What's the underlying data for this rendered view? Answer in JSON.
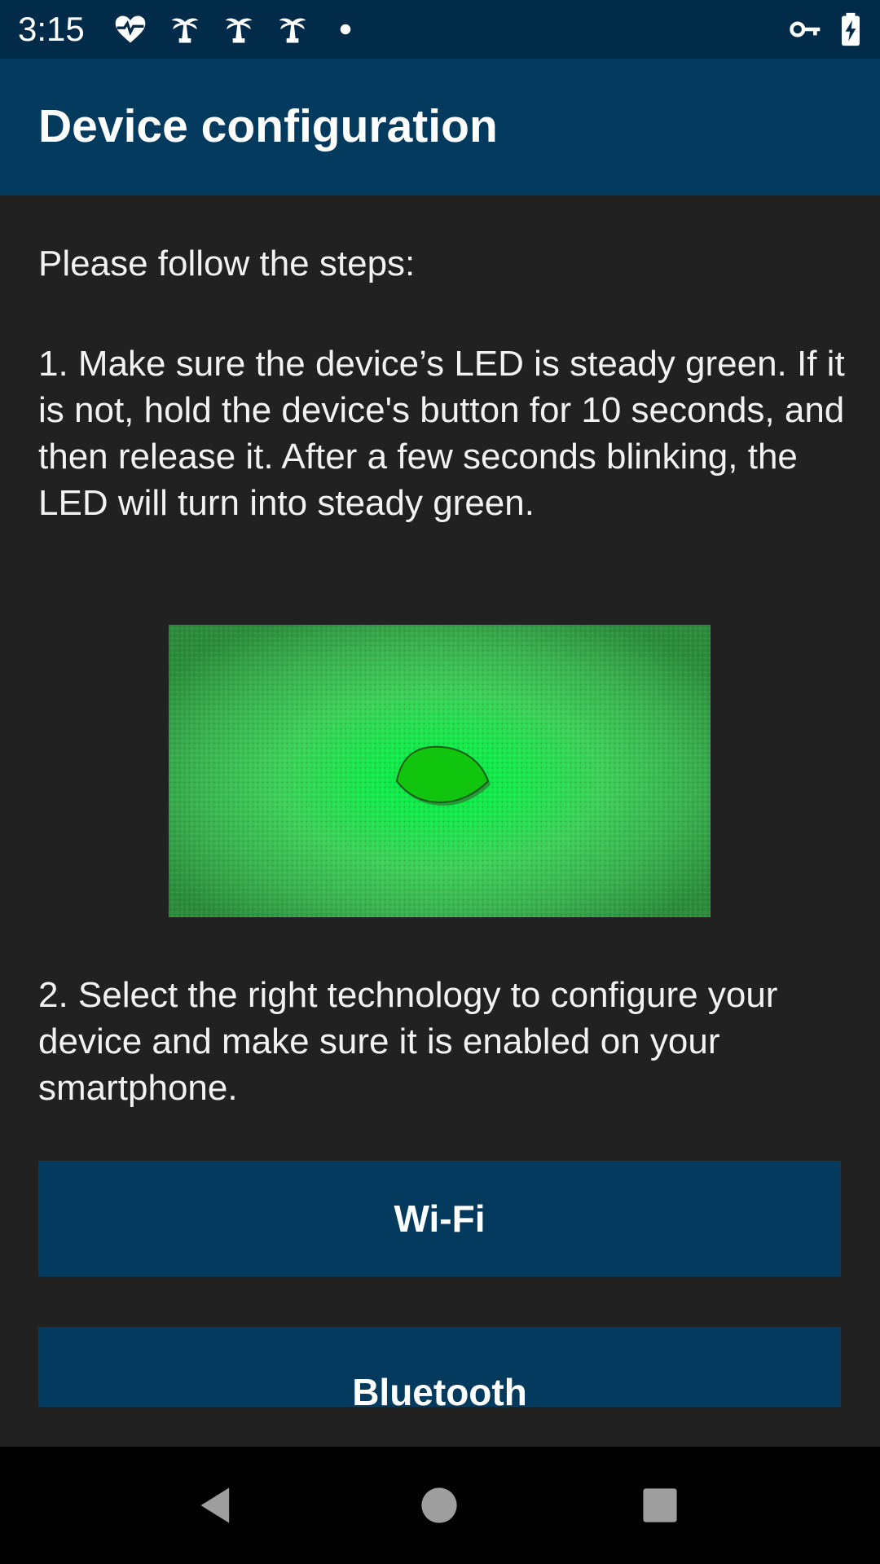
{
  "status_bar": {
    "time": "3:15",
    "icons_left": [
      "heart-pulse-icon",
      "palm-tree-icon",
      "palm-tree-icon",
      "palm-tree-icon",
      "dot-icon"
    ],
    "icons_right": [
      "vpn-key-icon",
      "battery-charging-icon"
    ]
  },
  "app_bar": {
    "title": "Device configuration"
  },
  "content": {
    "intro": "Please follow the steps:",
    "step1": "1. Make sure the device’s LED is steady green. If it is not, hold the device's button for 10 seconds, and then release it. After a few seconds blinking, the LED will turn into steady green.",
    "step2": "2. Select the right technology to configure your device and make sure it is enabled on your smartphone.",
    "buttons": {
      "wifi": "Wi-Fi",
      "bluetooth": "Bluetooth"
    }
  },
  "nav_bar": {
    "icons": [
      "back-icon",
      "home-icon",
      "recents-icon"
    ]
  },
  "colors": {
    "status_bar": "#012b48",
    "app_bar": "#033a5e",
    "background": "#212121",
    "button": "#033a5e",
    "led_green": "#1fe14a"
  }
}
